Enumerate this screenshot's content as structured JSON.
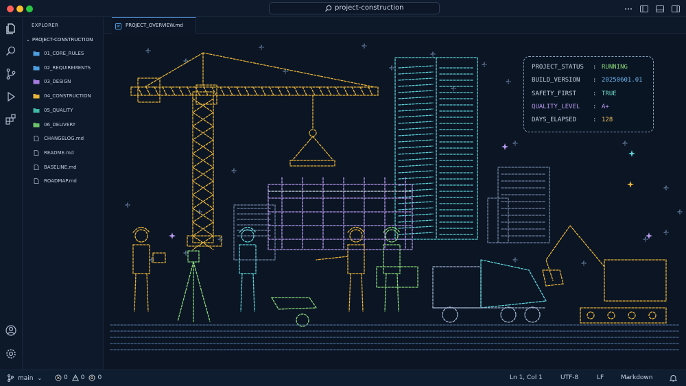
{
  "window": {
    "search_text": "project-construction",
    "traffic_lights": [
      "#ff5f57",
      "#febc2e",
      "#28c840"
    ]
  },
  "explorer": {
    "title": "EXPLORER",
    "root": "PROJECT-CONSTRUCTION",
    "items": [
      {
        "label": "01_CORE_RULES",
        "type": "folder",
        "color": "#4d9de0"
      },
      {
        "label": "02_REQUIREMENTS",
        "type": "folder",
        "color": "#4d9de0"
      },
      {
        "label": "03_DESIGN",
        "type": "folder",
        "color": "#a77be0"
      },
      {
        "label": "04_CONSTRUCTION",
        "type": "folder",
        "color": "#e8b43a"
      },
      {
        "label": "05_QUALITY",
        "type": "folder",
        "color": "#3fb9a8"
      },
      {
        "label": "06_DELIVERY",
        "type": "folder",
        "color": "#6cc36a"
      },
      {
        "label": "CHANGELOG.md",
        "type": "file"
      },
      {
        "label": "README.md",
        "type": "file"
      },
      {
        "label": "BASELINE.md",
        "type": "file"
      },
      {
        "label": "ROADMAP.md",
        "type": "file"
      }
    ]
  },
  "tabs": [
    {
      "label": "PROJECT_OVERVIEW.md",
      "active": true
    }
  ],
  "status_panel": [
    {
      "key": "PROJECT_STATUS",
      "value": "RUNNING",
      "key_color": "#c7d3e3",
      "value_color": "#8bd97a"
    },
    {
      "key": "BUILD_VERSION",
      "value": "20250601.01",
      "key_color": "#c7d3e3",
      "value_color": "#6fb8f0"
    },
    {
      "key": "SAFETY_FIRST",
      "value": "TRUE",
      "key_color": "#c7d3e3",
      "value_color": "#6fe0d0"
    },
    {
      "key": "QUALITY_LEVEL",
      "value": "A+",
      "key_color": "#b99cf0",
      "value_color": "#b99cf0"
    },
    {
      "key": "DAYS_ELAPSED",
      "value": "128",
      "key_color": "#c7d3e3",
      "value_color": "#f0c45a"
    }
  ],
  "statusbar": {
    "branch": "main",
    "errors": "0",
    "warnings": "0",
    "ports": "0",
    "cursor": "Ln 1, Col 1",
    "encoding": "UTF-8",
    "eol": "LF",
    "language": "Markdown"
  },
  "colors": {
    "yellow": "#e8b43a",
    "cyan": "#5fd3d8",
    "green": "#8bd97a",
    "purple": "#b99cf0",
    "white": "#d8e2f0"
  }
}
